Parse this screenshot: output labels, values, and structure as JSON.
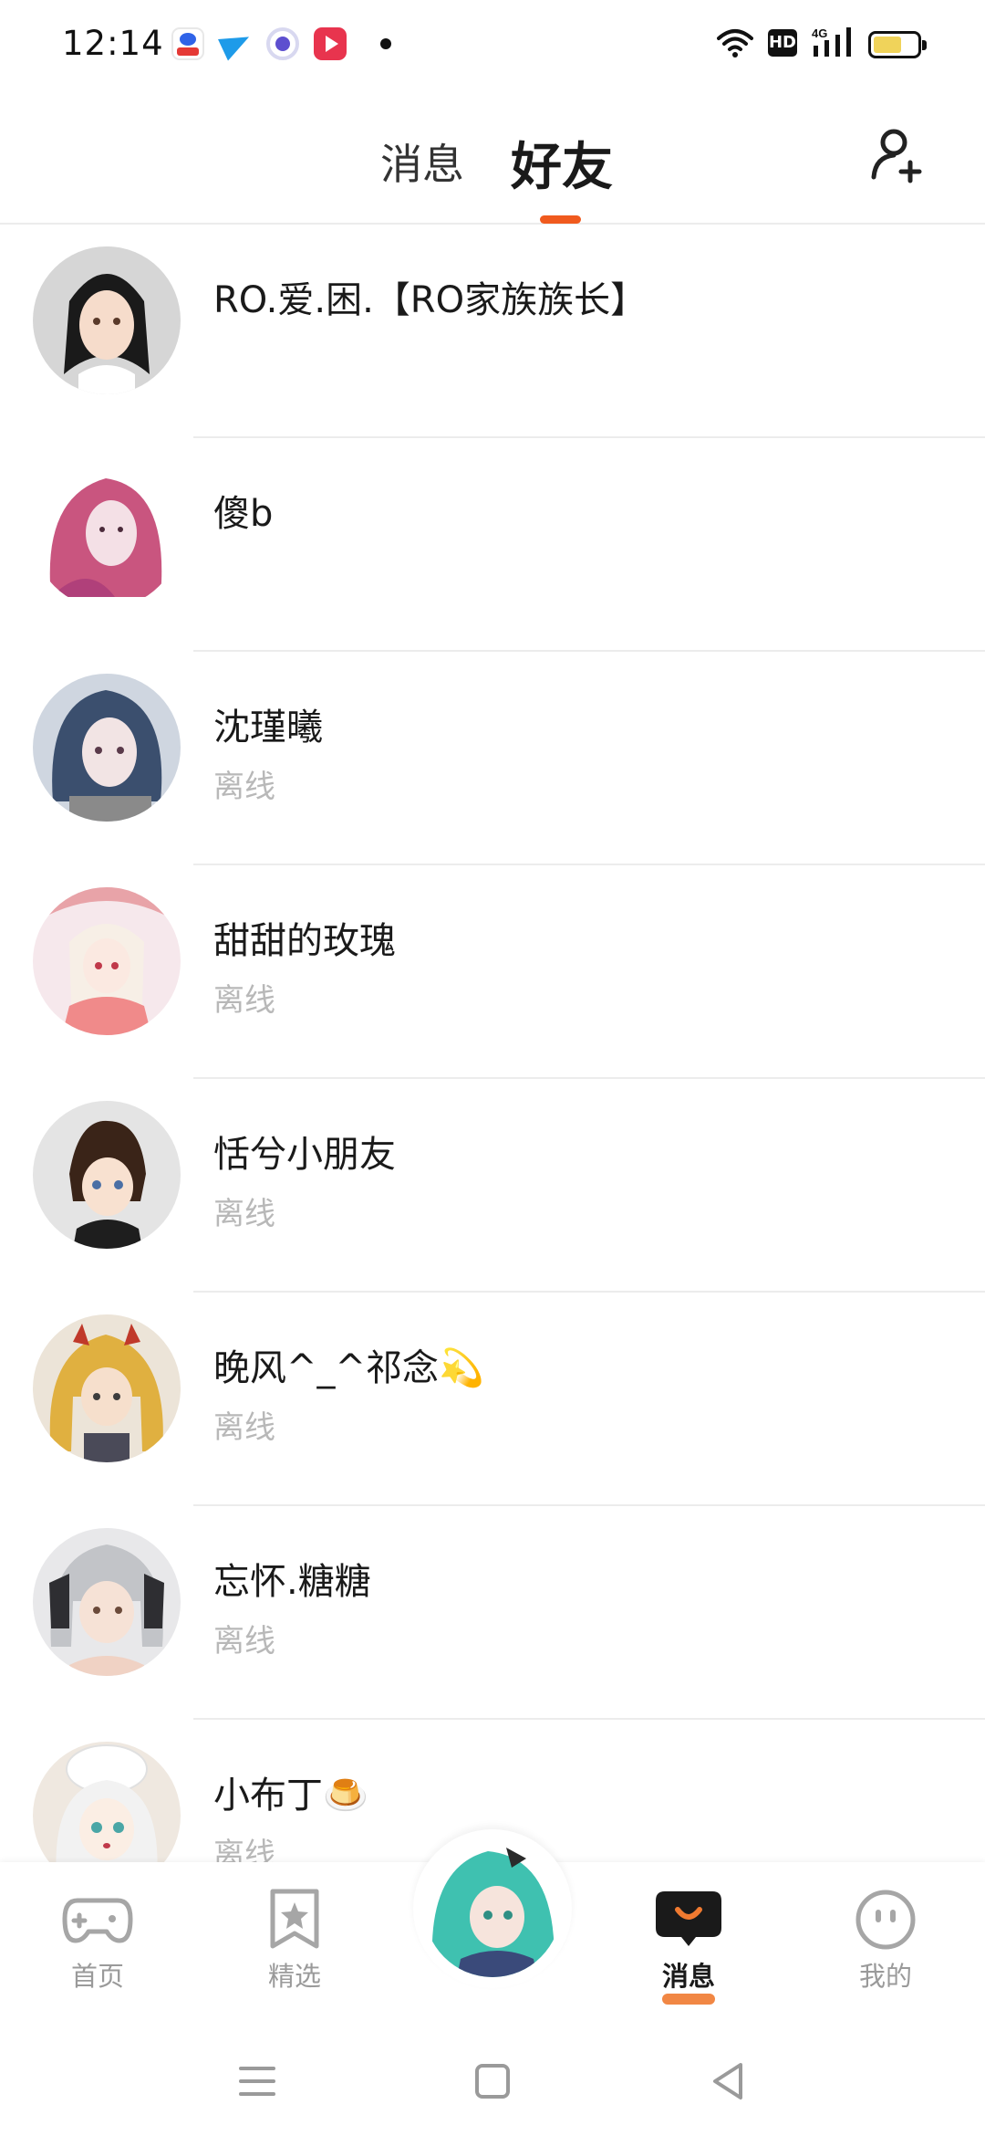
{
  "status_bar": {
    "time": "12:14",
    "hd_label": "HD",
    "network_label": "4G",
    "battery_level": 0.58
  },
  "header": {
    "tabs": [
      {
        "label": "消息",
        "active": false
      },
      {
        "label": "好友",
        "active": true
      }
    ],
    "accent_color": "#f05a1e",
    "add_friend_icon": "add-user-icon"
  },
  "friends": [
    {
      "name": "RO.爱.困.【RO家族族长】",
      "status": ""
    },
    {
      "name": "傻b",
      "status": ""
    },
    {
      "name": "沈瑾曦",
      "status": "离线"
    },
    {
      "name": "甜甜的玫瑰",
      "status": "离线"
    },
    {
      "name": "恬兮小朋友",
      "status": "离线"
    },
    {
      "name": "晚风^_^祁念💫",
      "status": "离线"
    },
    {
      "name": "忘怀.糖糖",
      "status": "离线"
    },
    {
      "name": "小布丁🍮",
      "status": "离线"
    }
  ],
  "bottom_nav": {
    "items": [
      {
        "label": "首页",
        "icon": "gamepad-icon",
        "active": false
      },
      {
        "label": "精选",
        "icon": "star-bookmark-icon",
        "active": false
      },
      {
        "label": "",
        "icon": "center-avatar",
        "active": false
      },
      {
        "label": "消息",
        "icon": "chat-bubble-icon",
        "active": true
      },
      {
        "label": "我的",
        "icon": "face-icon",
        "active": false
      }
    ]
  },
  "system_nav": {
    "buttons": [
      "menu-icon",
      "home-square-icon",
      "back-triangle-icon"
    ]
  }
}
